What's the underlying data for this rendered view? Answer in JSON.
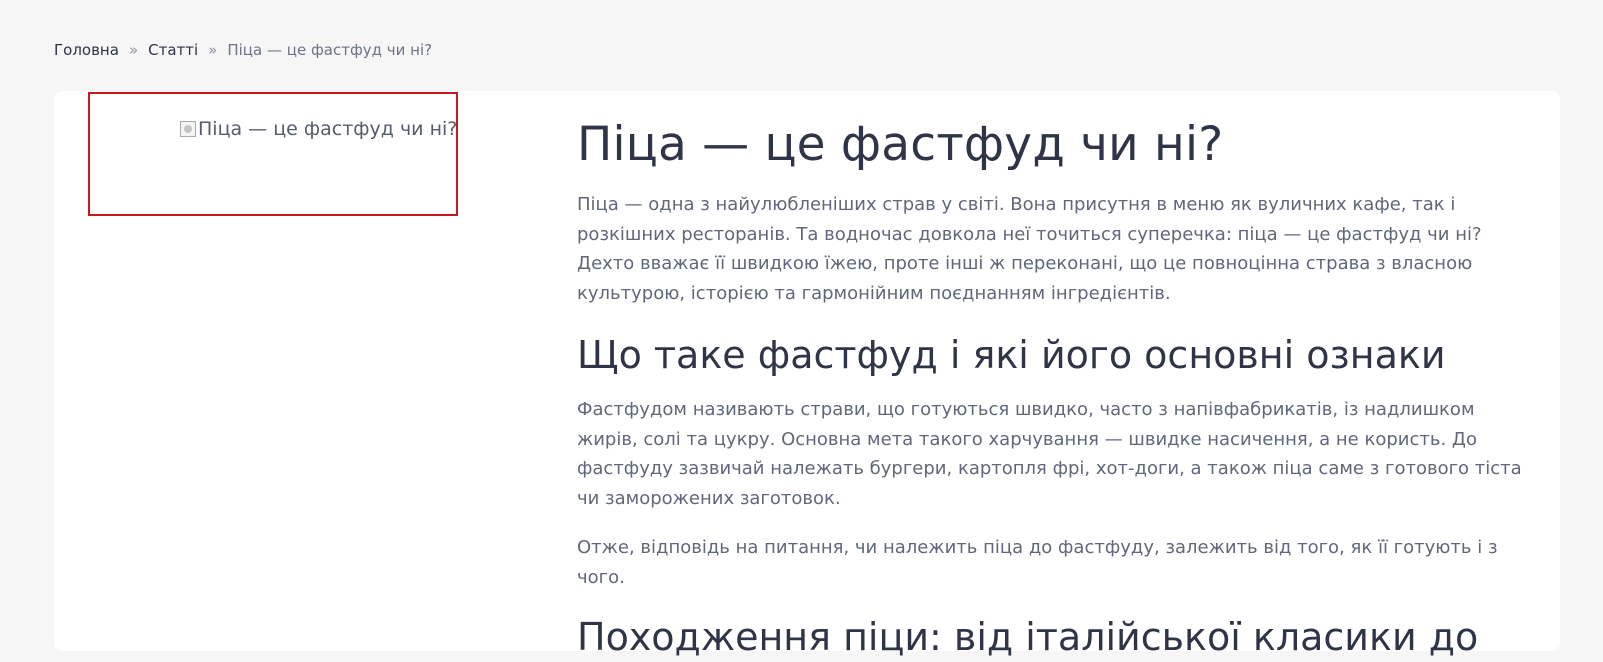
{
  "breadcrumb": {
    "home": "Головна",
    "separator": "»",
    "articles": "Статті",
    "current": "Піца — це фастфуд чи ні?"
  },
  "image": {
    "alt": "Піца — це фастфуд чи ні?"
  },
  "article": {
    "title": "Піца — це фастфуд чи ні?",
    "intro": "Піца — одна з найулюбленіших страв у світі. Вона присутня в меню як вуличних кафе, так і розкішних ресторанів. Та водночас довкола неї точиться суперечка: піца — це фастфуд чи ні? Дехто вважає її швидкою їжею, проте інші ж переконані, що це повноцінна страва з власною культурою, історією та гармонійним поєднанням інгредієнтів.",
    "section1_title": "Що таке фастфуд і які його основні ознаки",
    "section1_p1": "Фастфудом називають страви, що готуються швидко, часто з напівфабрикатів, із надлишком жирів, солі та цукру. Основна мета такого харчування — швидке насичення, а не користь. До фастфуду зазвичай належать бургери, картопля фрі, хот-доги, а також піца саме з готового тіста чи заморожених заготовок.",
    "section1_p2": "Отже, відповідь на питання, чи належить піца до фастфуду, залежить від того, як її готують і з чого.",
    "section2_title": "Походження піци: від італійської класики до"
  },
  "colors": {
    "page_bg": "#f6f6f6",
    "card_bg": "#ffffff",
    "heading": "#2f3546",
    "body_text": "#60677a",
    "highlight_border": "#c9161f"
  }
}
